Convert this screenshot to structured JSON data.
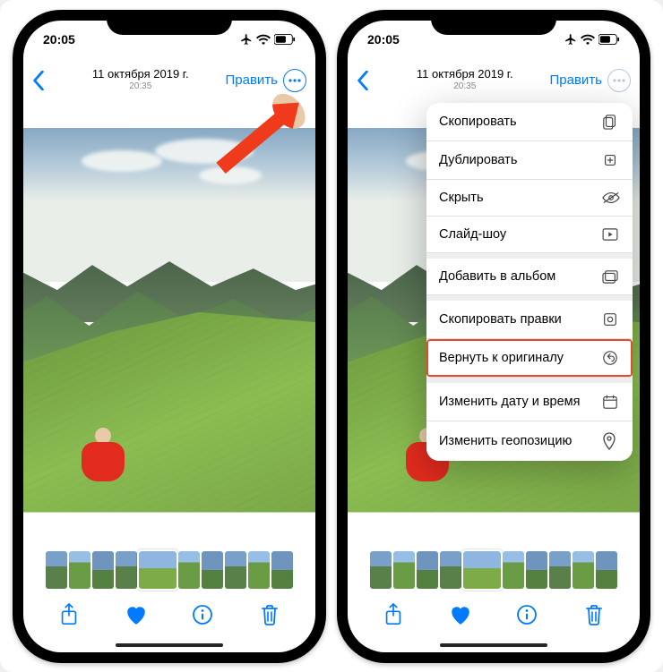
{
  "status": {
    "time": "20:05"
  },
  "nav": {
    "date": "11 октября 2019 г.",
    "time": "20:35",
    "edit": "Править"
  },
  "menu": {
    "copy": "Скопировать",
    "duplicate": "Дублировать",
    "hide": "Скрыть",
    "slideshow": "Слайд-шоу",
    "add_album": "Добавить в альбом",
    "copy_edits": "Скопировать правки",
    "revert": "Вернуть к оригиналу",
    "edit_date": "Изменить дату и время",
    "edit_location": "Изменить геопозицию"
  }
}
